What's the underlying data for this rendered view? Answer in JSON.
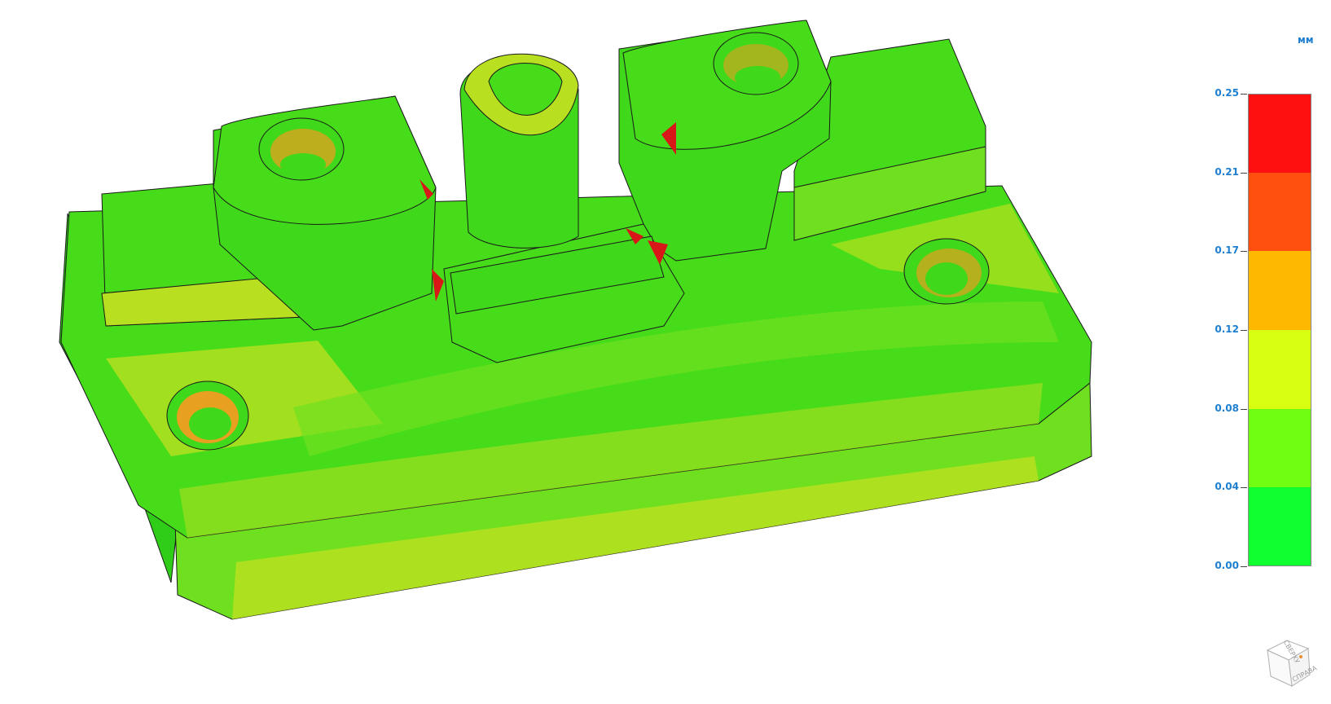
{
  "legend": {
    "unit": "мм",
    "ticks": [
      "0.25",
      "0.21",
      "0.17",
      "0.12",
      "0.08",
      "0.04",
      "0.00"
    ],
    "bands": [
      "#ff1010",
      "#ff5010",
      "#ffb800",
      "#d8ff10",
      "#70ff10",
      "#10ff30"
    ]
  },
  "view_cube": {
    "top_face": "СВЕРХУ",
    "right_face": "СПРАВА"
  },
  "colors": {
    "green_main": "#3fd81a",
    "green_light": "#6fe020",
    "yellow_green": "#b8e020",
    "orange": "#e8a020",
    "red": "#d81818",
    "outline": "#1a1a1a"
  }
}
